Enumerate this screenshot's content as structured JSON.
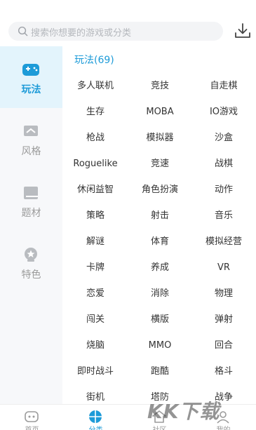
{
  "search": {
    "placeholder": "搜索你想要的游戏或分类"
  },
  "sidebar": {
    "items": [
      {
        "label": "玩法",
        "icon": "gamepad-icon",
        "active": true
      },
      {
        "label": "风格",
        "icon": "style-icon",
        "active": false
      },
      {
        "label": "题材",
        "icon": "book-icon",
        "active": false
      },
      {
        "label": "特色",
        "icon": "star-badge-icon",
        "active": false
      }
    ]
  },
  "section": {
    "title": "玩法(69)"
  },
  "categories": [
    "多人联机",
    "竞技",
    "自走棋",
    "生存",
    "MOBA",
    "IO游戏",
    "枪战",
    "模拟器",
    "沙盒",
    "Roguelike",
    "竞速",
    "战棋",
    "休闲益智",
    "角色扮演",
    "动作",
    "策略",
    "射击",
    "音乐",
    "解谜",
    "体育",
    "模拟经营",
    "卡牌",
    "养成",
    "VR",
    "恋爱",
    "消除",
    "物理",
    "闯关",
    "横版",
    "弹射",
    "烧脑",
    "MMO",
    "回合",
    "即时战斗",
    "跑酷",
    "格斗",
    "街机",
    "塔防",
    "战争"
  ],
  "bottom_tabs": [
    {
      "label": "首页",
      "icon": "home-game-icon",
      "active": false
    },
    {
      "label": "分类",
      "icon": "category-icon",
      "active": true
    },
    {
      "label": "社区",
      "icon": "community-icon",
      "active": false
    },
    {
      "label": "我的",
      "icon": "profile-icon",
      "active": false
    }
  ],
  "watermark": "KK下载",
  "colors": {
    "accent": "#1d9bd8",
    "active_bg": "#e3f4fc",
    "muted": "#9b9b9b"
  }
}
